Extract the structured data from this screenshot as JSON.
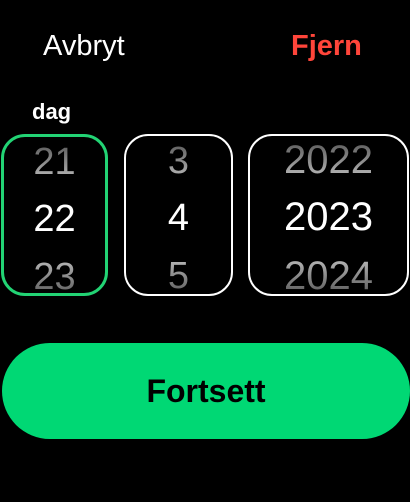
{
  "header": {
    "cancel_label": "Avbryt",
    "remove_label": "Fjern"
  },
  "picker": {
    "selected_label": "dag",
    "day": {
      "prev": "21",
      "current": "22",
      "next": "23"
    },
    "month": {
      "prev": "3",
      "current": "4",
      "next": "5"
    },
    "year": {
      "prev": "2022",
      "current": "2023",
      "next": "2024"
    }
  },
  "footer": {
    "continue_label": "Fortsett"
  },
  "colors": {
    "background": "#000000",
    "remove_text": "#ff453a",
    "selected_border": "#22d374",
    "continue_button": "#00d874"
  }
}
